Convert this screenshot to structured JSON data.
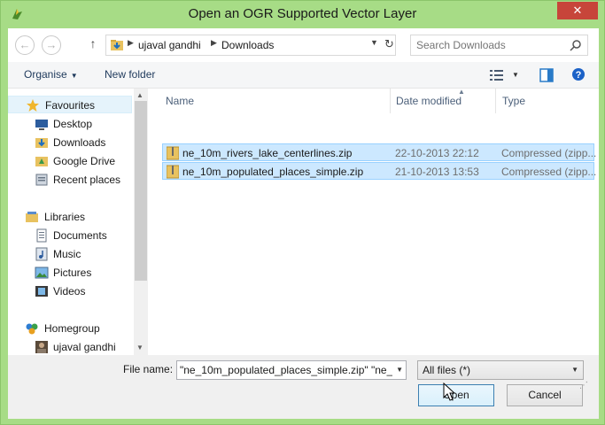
{
  "window": {
    "title": "Open an OGR Supported Vector Layer",
    "close_label": "✕",
    "accent": "#a7dc86"
  },
  "address": {
    "crumbs": [
      "ujaval gandhi",
      "Downloads"
    ],
    "back_icon": "back-arrow-icon",
    "forward_icon": "forward-arrow-icon",
    "up_icon": "up-arrow-icon",
    "refresh_icon": "refresh-icon"
  },
  "search": {
    "placeholder": "Search Downloads"
  },
  "toolbar": {
    "organise_label": "Organise",
    "new_folder_label": "New folder"
  },
  "sidebar": {
    "items": [
      {
        "label": "Favourites",
        "icon": "star-icon"
      },
      {
        "label": "Desktop",
        "icon": "desktop-icon"
      },
      {
        "label": "Downloads",
        "icon": "downloads-icon"
      },
      {
        "label": "Google Drive",
        "icon": "google-drive-icon"
      },
      {
        "label": "Recent places",
        "icon": "recent-places-icon"
      },
      {
        "label": "Libraries",
        "icon": "libraries-icon"
      },
      {
        "label": "Documents",
        "icon": "documents-icon"
      },
      {
        "label": "Music",
        "icon": "music-icon"
      },
      {
        "label": "Pictures",
        "icon": "pictures-icon"
      },
      {
        "label": "Videos",
        "icon": "videos-icon"
      },
      {
        "label": "Homegroup",
        "icon": "homegroup-icon"
      },
      {
        "label": "ujaval gandhi",
        "icon": "user-avatar-icon"
      }
    ]
  },
  "file_list": {
    "columns": [
      "Name",
      "Date modified",
      "Type"
    ],
    "rows": [
      {
        "name": "ne_10m_rivers_lake_centerlines.zip",
        "date": "22-10-2013 22:12",
        "type": "Compressed (zipp..."
      },
      {
        "name": "ne_10m_populated_places_simple.zip",
        "date": "21-10-2013 13:53",
        "type": "Compressed (zipp..."
      }
    ]
  },
  "bottom": {
    "file_name_label": "File name:",
    "file_name_value": "\"ne_10m_populated_places_simple.zip\" \"ne_1",
    "filter_value": "All files (*)",
    "open_label": "Open",
    "cancel_label": "Cancel"
  }
}
